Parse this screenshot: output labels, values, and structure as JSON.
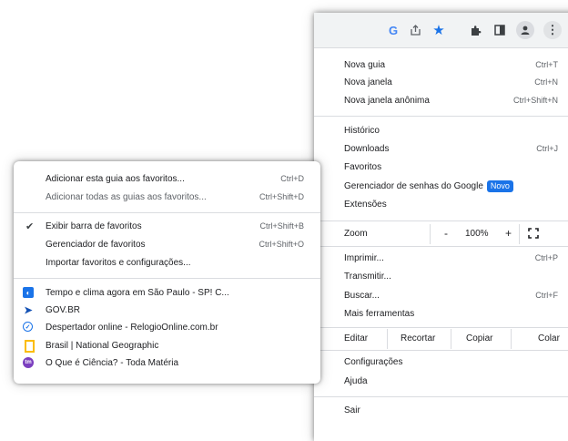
{
  "toolbar": {
    "icons": [
      "google-icon",
      "share-icon",
      "bookmark-star-icon",
      "extensions-icon",
      "side-panel-icon",
      "profile-icon",
      "more-menu-icon"
    ],
    "g_glyph": "G"
  },
  "main_menu": {
    "nova_guia": {
      "label": "Nova guia",
      "shortcut": "Ctrl+T"
    },
    "nova_janela": {
      "label": "Nova janela",
      "shortcut": "Ctrl+N"
    },
    "nova_janela_anonima": {
      "label": "Nova janela anônima",
      "shortcut": "Ctrl+Shift+N"
    },
    "historico": {
      "label": "Histórico"
    },
    "downloads": {
      "label": "Downloads",
      "shortcut": "Ctrl+J"
    },
    "favoritos": {
      "label": "Favoritos"
    },
    "senhas": {
      "label": "Gerenciador de senhas do Google",
      "badge": "Novo"
    },
    "extensoes": {
      "label": "Extensões"
    },
    "zoom": {
      "label": "Zoom",
      "minus": "-",
      "value": "100%",
      "plus": "+"
    },
    "imprimir": {
      "label": "Imprimir...",
      "shortcut": "Ctrl+P"
    },
    "transmitir": {
      "label": "Transmitir..."
    },
    "buscar": {
      "label": "Buscar...",
      "shortcut": "Ctrl+F"
    },
    "mais_ferramentas": {
      "label": "Mais ferramentas"
    },
    "edit": {
      "label": "Editar",
      "cut": "Recortar",
      "copy": "Copiar",
      "paste": "Colar"
    },
    "configuracoes": {
      "label": "Configurações"
    },
    "ajuda": {
      "label": "Ajuda"
    },
    "sair": {
      "label": "Sair"
    }
  },
  "bookmarks_menu": {
    "add_this": {
      "label": "Adicionar esta guia aos favoritos...",
      "shortcut": "Ctrl+D"
    },
    "add_all": {
      "label": "Adicionar todas as guias aos favoritos...",
      "shortcut": "Ctrl+Shift+D"
    },
    "show_bar": {
      "label": "Exibir barra de favoritos",
      "shortcut": "Ctrl+Shift+B",
      "checked": true
    },
    "manager": {
      "label": "Gerenciador de favoritos",
      "shortcut": "Ctrl+Shift+O"
    },
    "import": {
      "label": "Importar favoritos e configurações..."
    },
    "bookmarks": [
      {
        "title": "Tempo e clima agora em São Paulo - SP! C...",
        "icon": "weather-favicon"
      },
      {
        "title": "GOV.BR",
        "icon": "govbr-favicon"
      },
      {
        "title": "Despertador online - RelogioOnline.com.br",
        "icon": "alarm-clock-favicon"
      },
      {
        "title": "Brasil | National Geographic",
        "icon": "natgeo-favicon"
      },
      {
        "title": "O Que é Ciência? - Toda Matéria",
        "icon": "todamateria-favicon"
      }
    ]
  }
}
